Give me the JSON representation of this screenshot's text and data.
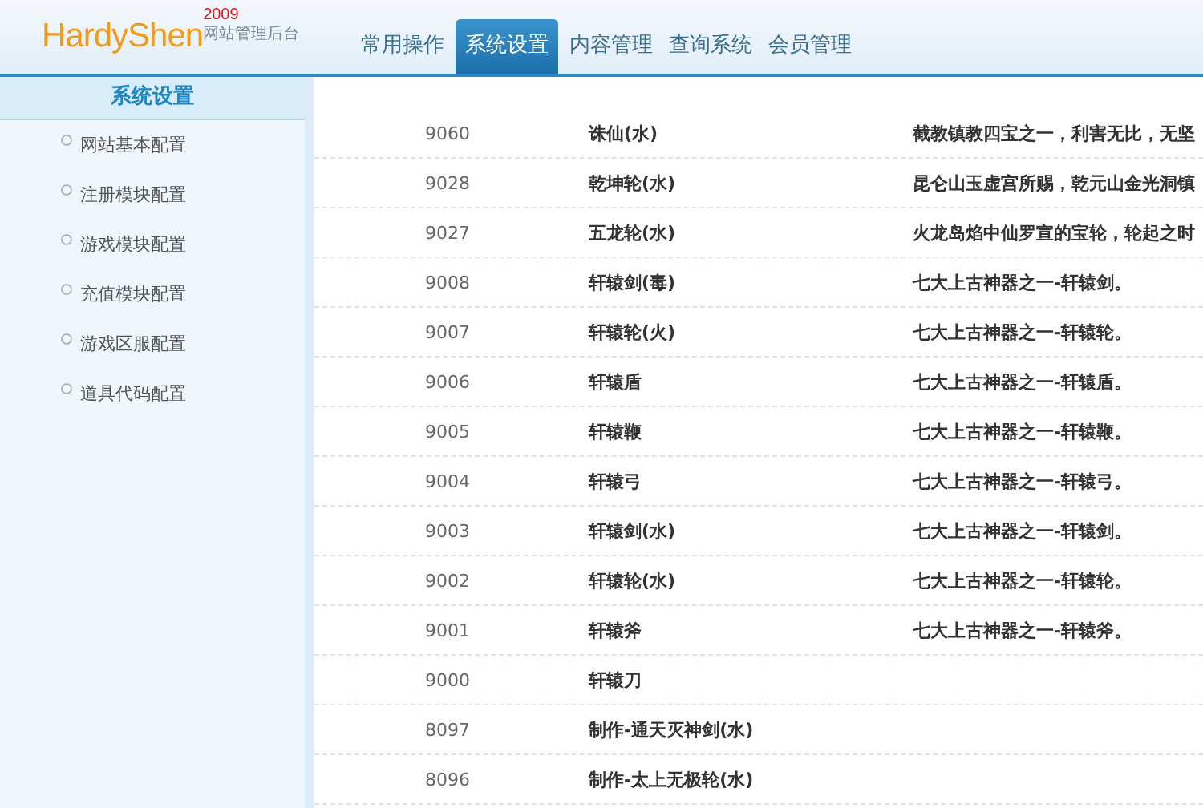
{
  "logo": {
    "name": "HardyShen",
    "year": "2009",
    "subtitle": "网站管理后台"
  },
  "tabs": [
    {
      "label": "常用操作",
      "selected": false
    },
    {
      "label": "系统设置",
      "selected": true
    },
    {
      "label": "内容管理",
      "selected": false
    },
    {
      "label": "查询系统",
      "selected": false
    },
    {
      "label": "会员管理",
      "selected": false
    }
  ],
  "sidebar": {
    "title": "系统设置",
    "items": [
      "网站基本配置",
      "注册模块配置",
      "游戏模块配置",
      "充值模块配置",
      "游戏区服配置",
      "道具代码配置"
    ]
  },
  "table": {
    "rows": [
      [
        "9060",
        "诛仙(水)",
        "截教镇教四宝之一，利害无比，无坚"
      ],
      [
        "9028",
        "乾坤轮(水)",
        "昆仑山玉虚宫所赐，乾元山金光洞镇"
      ],
      [
        "9027",
        "五龙轮(水)",
        "火龙岛焰中仙罗宣的宝轮，轮起之时"
      ],
      [
        "9008",
        "轩辕剑(毒)",
        "七大上古神器之一-轩辕剑。"
      ],
      [
        "9007",
        "轩辕轮(火)",
        "七大上古神器之一-轩辕轮。"
      ],
      [
        "9006",
        "轩辕盾",
        "七大上古神器之一-轩辕盾。"
      ],
      [
        "9005",
        "轩辕鞭",
        "七大上古神器之一-轩辕鞭。"
      ],
      [
        "9004",
        "轩辕弓",
        "七大上古神器之一-轩辕弓。"
      ],
      [
        "9003",
        "轩辕剑(水)",
        "七大上古神器之一-轩辕剑。"
      ],
      [
        "9002",
        "轩辕轮(水)",
        "七大上古神器之一-轩辕轮。"
      ],
      [
        "9001",
        "轩辕斧",
        "七大上古神器之一-轩辕斧。"
      ],
      [
        "9000",
        "轩辕刀"
      ],
      [
        "8097",
        "制作-通天灭神剑(水)"
      ],
      [
        "8096",
        "制作-太上无极轮(水)"
      ]
    ]
  }
}
